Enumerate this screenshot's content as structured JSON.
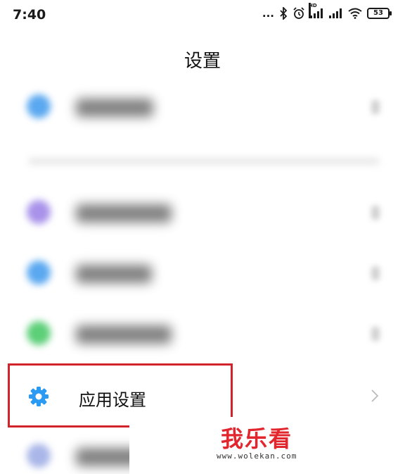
{
  "status_bar": {
    "time": "7:40",
    "dots": "...",
    "hd_label": "HD",
    "battery": "53",
    "icons": [
      "bluetooth-icon",
      "alarm-icon",
      "signal-icon",
      "signal-icon",
      "wifi-icon",
      "battery-icon"
    ]
  },
  "header": {
    "title": "设置"
  },
  "rows": [
    {
      "icon_color": "#5aa8f0",
      "state": "blurred"
    },
    {
      "icon_color": "#a892ea",
      "state": "blurred"
    },
    {
      "icon_color": "#5aa8f0",
      "state": "blurred"
    },
    {
      "icon_color": "#5ccf78",
      "state": "blurred"
    },
    {
      "icon_color": "#a9b6e8",
      "state": "blurred"
    }
  ],
  "app_settings": {
    "label": "应用设置",
    "icon": "gear-icon",
    "icon_color": "#2b9af3"
  },
  "highlight_color": "#d2232a",
  "watermark": {
    "title": "我乐看",
    "url": "www.wolekan.com",
    "color": "#e1262d"
  }
}
